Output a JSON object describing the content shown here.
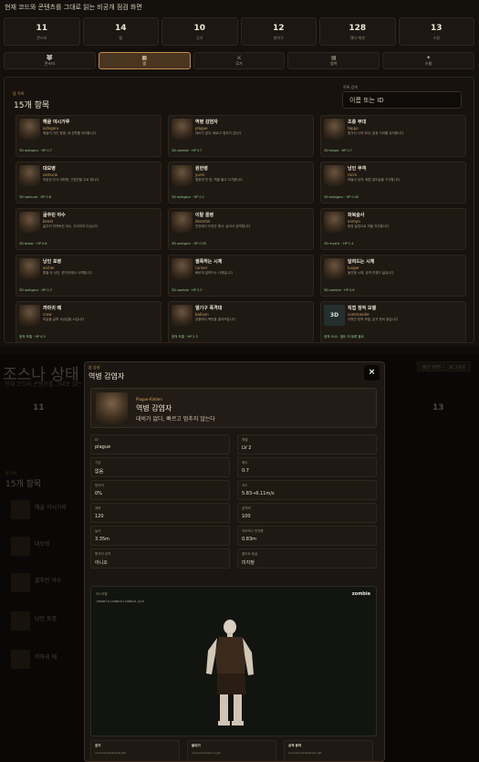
{
  "header": {
    "subtitle": "현재 코드와 콘텐츠를 그대로 읽는 비공개 점검 화면"
  },
  "stats": [
    {
      "value": "11",
      "label": "몬스터"
    },
    {
      "value": "14",
      "label": "맵"
    },
    {
      "value": "10",
      "label": "무기"
    },
    {
      "value": "12",
      "label": "방어구"
    },
    {
      "value": "128",
      "label": "렌더 에셋"
    },
    {
      "value": "13",
      "label": "스킬"
    }
  ],
  "tabs": [
    {
      "icon": "🐺",
      "label": "몬스터"
    },
    {
      "icon": "▦",
      "label": "맵"
    },
    {
      "icon": "⚔",
      "label": "무기"
    },
    {
      "icon": "▤",
      "label": "방어"
    },
    {
      "icon": "✦",
      "label": "스킬"
    }
  ],
  "list": {
    "section_label": "몹 목록",
    "title": "15개 항목",
    "search_label": "목록 검색",
    "search_placeholder": "이름 또는 ID"
  },
  "cards": [
    {
      "name": "해골 야시가루",
      "id": "ashigaru",
      "desc": "해골이 가진 창병, 새 전투를 의미합니다",
      "foot": "3D ashigaru · HP 0.7",
      "thumb": "skull-warrior"
    },
    {
      "name": "역병 감염자",
      "id": "plague",
      "desc": "대비가 없다, 빠르고 멈추지 않는다",
      "foot": "3D zombie · HP 0.7",
      "thumb": "plague-zombie"
    },
    {
      "name": "조총 부대",
      "id": "teppo",
      "desc": "원거리 사격 부대, 일정 거리를 유지합니다",
      "foot": "3D teppo · HP 0.7",
      "thumb": "gunner"
    },
    {
      "name": "대모병",
      "id": "samurai",
      "desc": "미완성 무사 대모병, 근접전을 주로 합니다",
      "foot": "3D samurai · HP 0.8",
      "thumb": "samurai"
    },
    {
      "name": "원한령",
      "id": "yurei",
      "desc": "원한에 찬 령, 벽을 뚫고 다가옵니다",
      "foot": "3D ashigaru · HP 0.1",
      "thumb": "ghost"
    },
    {
      "name": "낭인 무객",
      "id": "ronin",
      "desc": "떠돌이 검객, 빠른 발도술을 구사합니다",
      "foot": "3D ashigaru · HP 0.45",
      "thumb": "ronin"
    },
    {
      "name": "굶주린 야수",
      "id": "beast",
      "desc": "굶주려 미쳐버린 야수, 무리지어 다닙니다",
      "foot": "3D beast · HP 0.6",
      "thumb": "beast"
    },
    {
      "name": "이탈 졸병",
      "id": "deserter",
      "desc": "전장에서 도망친 병사, 숨어서 공격합니다",
      "foot": "3D ashigaru · HP 0.55",
      "thumb": "deserter"
    },
    {
      "name": "화복술사",
      "id": "onmyo",
      "desc": "음양 술법으로 적을 저주합니다",
      "foot": "3D mystic · HP 1.4",
      "thumb": "sorcerer"
    },
    {
      "name": "낭인 포병",
      "id": "archer",
      "desc": "활을 든 낭인, 원거리에서 사격합니다",
      "foot": "3D ashigaru · HP 0.7",
      "thumb": "archer"
    },
    {
      "name": "썰폭하는 시체",
      "id": "runner",
      "desc": "빠르게 달려드는 시체입니다",
      "foot": "3D zombie · HP 3.3",
      "thumb": "runner"
    },
    {
      "name": "달려드는 시체",
      "id": "lunger",
      "desc": "돌진형 시체, 공격 반경이 넓습니다",
      "foot": "3D zombie · HP 0.6",
      "thumb": "lunger"
    },
    {
      "name": "까마귀 떼",
      "id": "crow",
      "desc": "하늘을 날며 사냥감을 노립니다",
      "foot": "정적 모델 · HP 0.5",
      "thumb": "crow"
    },
    {
      "name": "엘기구 폭격대",
      "id": "balloon",
      "desc": "공중에서 폭탄을 떨어뜨립니다",
      "foot": "정적 모델 · HP 2.3",
      "thumb": "balloon"
    },
    {
      "name": "직접 정적 모델",
      "id": "commander",
      "desc": "지휘관 정적 모델, 분석 준비 중입니다",
      "foot": "정적 GLB · 별도 적 등록 필요",
      "thumb": "3D"
    }
  ],
  "background": {
    "big_title": "조스나 상태",
    "subtitle": "현재 코드와 콘텐츠를 그대로 읽는 비공개 점검 화면",
    "buttons": [
      "메인 화면",
      "로그아웃"
    ],
    "stats": [
      "11",
      "13"
    ],
    "section_label": "몹 목록",
    "title": "15개 항목",
    "rows": [
      "해골 야시가루",
      "대모병",
      "굶주린 야수",
      "낭인 포병",
      "까마귀 떼"
    ]
  },
  "modal": {
    "label": "몹 상세",
    "title": "역병 감염자",
    "close": "×",
    "hero": {
      "key": "Plague-Ridden",
      "name": "역병 감염자",
      "desc": "대비가 없다, 빠르고 멈추지 않는다"
    },
    "fields": [
      {
        "k": "ID",
        "v": "plague"
      },
      {
        "k": "레벨",
        "v": "LV 2"
      },
      {
        "k": "기본",
        "v": "없음"
      },
      {
        "k": "배수",
        "v": "0.7"
      },
      {
        "k": "방어력",
        "v": "0%"
      },
      {
        "k": "속도",
        "v": "5.83→6.11m/s"
      },
      {
        "k": "체력",
        "v": "120"
      },
      {
        "k": "공격력",
        "v": "100"
      },
      {
        "k": "높이",
        "v": "3.35m"
      },
      {
        "k": "히트박스 반지름",
        "v": "0.83m"
      },
      {
        "k": "원거리 공격",
        "v": "아니오"
      },
      {
        "k": "엘리트 등급",
        "v": "미지정"
      }
    ],
    "model": {
      "label": "3D 모델",
      "path": "/models/zombie/zombie.glb",
      "tag": "zombie"
    },
    "files": [
      {
        "k": "걷기",
        "v": "/anim/zombie/walk.glb"
      },
      {
        "k": "달리기",
        "v": "/anim/zombie/run.glb"
      },
      {
        "k": "공격 동작",
        "v": "/anim/zombie/attack.glb"
      }
    ]
  }
}
